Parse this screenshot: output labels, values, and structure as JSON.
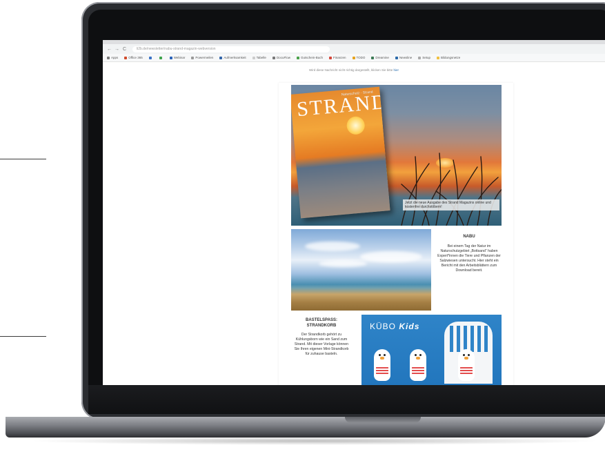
{
  "browser": {
    "nav": {
      "back": "←",
      "forward": "→",
      "reload": "C"
    },
    "address": "li2b.de/newsletter/nabu-strand-magazin-webversion"
  },
  "bookmarks": [
    {
      "label": "Apps",
      "color": "#7a7a7a"
    },
    {
      "label": "Office 365",
      "color": "#d04a2b"
    },
    {
      "label": "",
      "color": "#3b73c6"
    },
    {
      "label": "",
      "color": "#3fa34d"
    },
    {
      "label": "Webinar",
      "color": "#2a62b8"
    },
    {
      "label": "Powermeilen",
      "color": "#999999"
    },
    {
      "label": "Aufmerksamkeit",
      "color": "#3366aa"
    },
    {
      "label": "Tabelle",
      "color": "#cccccc"
    },
    {
      "label": "DocuFlow",
      "color": "#777777"
    },
    {
      "label": "Gutschein-Buch",
      "color": "#4aa14a"
    },
    {
      "label": "Finanzen",
      "color": "#d4473c"
    },
    {
      "label": "TODO",
      "color": "#e6a21d"
    },
    {
      "label": "Dreamine",
      "color": "#3c7a55"
    },
    {
      "label": "Newsline",
      "color": "#2b6aa9"
    },
    {
      "label": "Setup",
      "color": "#aaaaaa"
    },
    {
      "label": "Bildungsnetze",
      "color": "#f0c040"
    }
  ],
  "notice": {
    "text": "Wird diese Nachricht nicht richtig dargestellt, klicken Sie bitte ",
    "link": "hier"
  },
  "hero": {
    "magazine_title": "STRAND",
    "magazine_brand": "Naturschutz · Strand",
    "caption": "Jetzt die neue Ausgabe des Strand Magazins online und kostenfrei durchstöbern!"
  },
  "nabu": {
    "heading": "NABU",
    "text": "Bei einem Tag der Natur im Naturschutzgebiet „Bottsand“ haben Expert*innen die Tiere und Pflanzen der Salzwiesen untersucht. Hier steht ein Bericht mit den Arbeitsblättern zum Download bereit."
  },
  "bastel": {
    "heading": "BASTELSPASS: STRANDKORB",
    "text": "Der Strandkorb gehört zu Kühlungsborn wie ein Sand zum Strand. Mit dieser Vorlage können Sie Ihren eigenen Mini-Strandkorb für zuhause basteln."
  },
  "kubo": {
    "logo_prefix": "KÜBO",
    "logo_suffix": "Kids"
  }
}
